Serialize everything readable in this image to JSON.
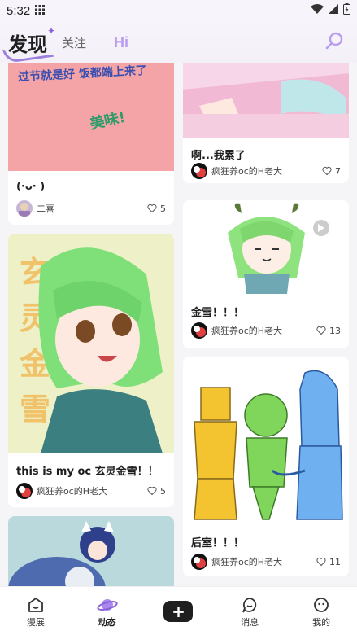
{
  "status": {
    "time": "5:32"
  },
  "header": {
    "tab_discover": "发现",
    "tab_follow": "关注",
    "tab_hi": "Hi"
  },
  "cards": [
    {
      "title": "(·ᴗ· )",
      "author": "二喜",
      "likes": "5",
      "image_text_top": "过节就是好 饭都端上来了",
      "image_text_mid": "美味!"
    },
    {
      "title": "this is my oc 玄灵金雪！！",
      "author": "疯狂养oc的H老大",
      "likes": "5",
      "image_text": "玄灵金雪"
    },
    {
      "title": "啊...我累了",
      "author": "疯狂养oc的H老大",
      "likes": "7"
    },
    {
      "title": "金雪！！！",
      "author": "疯狂养oc的H老大",
      "likes": "13"
    },
    {
      "title": "后室！！！",
      "author": "疯狂养oc的H老大",
      "likes": "11"
    }
  ],
  "nav": [
    {
      "label": "漫展",
      "icon": "home-icon"
    },
    {
      "label": "动态",
      "icon": "planet-icon"
    },
    {
      "label": "",
      "icon": "plus-icon"
    },
    {
      "label": "消息",
      "icon": "message-icon"
    },
    {
      "label": "我的",
      "icon": "profile-icon"
    }
  ]
}
